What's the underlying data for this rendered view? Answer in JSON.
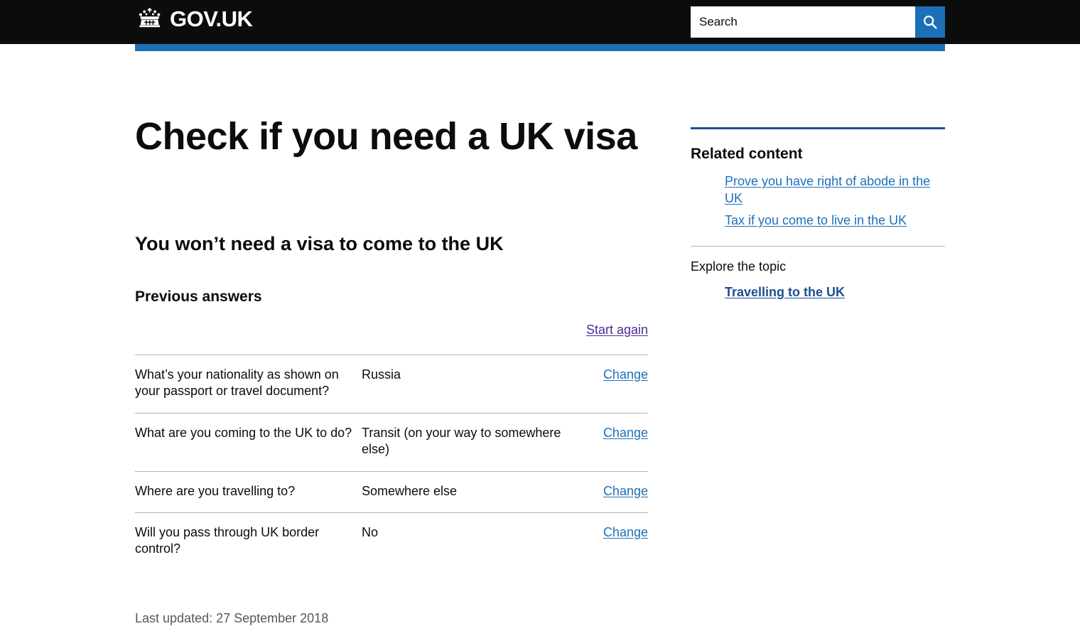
{
  "header": {
    "logo_text": "GOV.UK",
    "crown_icon": "crown-icon",
    "search": {
      "placeholder": "Search",
      "value": "",
      "button_icon": "search-icon",
      "button_label": "Search"
    },
    "accent_color": "#1d70b8",
    "background_color": "#0b0c0c"
  },
  "main": {
    "page_title": "Check if you need a UK visa",
    "outcome_title": "You won’t need a visa to come to the UK",
    "previous_answers_title": "Previous answers",
    "start_again_label": "Start again",
    "answers": [
      {
        "question": "What’s your nationality as shown on your passport or travel document?",
        "answer": "Russia",
        "action": "Change"
      },
      {
        "question": "What are you coming to the UK to do?",
        "answer": "Transit (on your way to somewhere else)",
        "action": "Change"
      },
      {
        "question": "Where are you travelling to?",
        "answer": "Somewhere else",
        "action": "Change"
      },
      {
        "question": "Will you pass through UK border control?",
        "answer": "No",
        "action": "Change"
      }
    ],
    "last_updated": "Last updated: 27 September 2018"
  },
  "sidebar": {
    "related_heading": "Related content",
    "related_links": [
      "Prove you have right of abode in the UK",
      "Tax if you come to live in the UK"
    ],
    "explore_label": "Explore the topic",
    "topic_links": [
      "Travelling to the UK"
    ]
  },
  "colors": {
    "link_blue": "#1d70b8",
    "link_visited_purple": "#4c2c92",
    "topic_blue": "#1d4f91",
    "text_black": "#0b0c0c",
    "muted_grey": "#505a5f",
    "rule_grey": "#b1b4b6"
  }
}
